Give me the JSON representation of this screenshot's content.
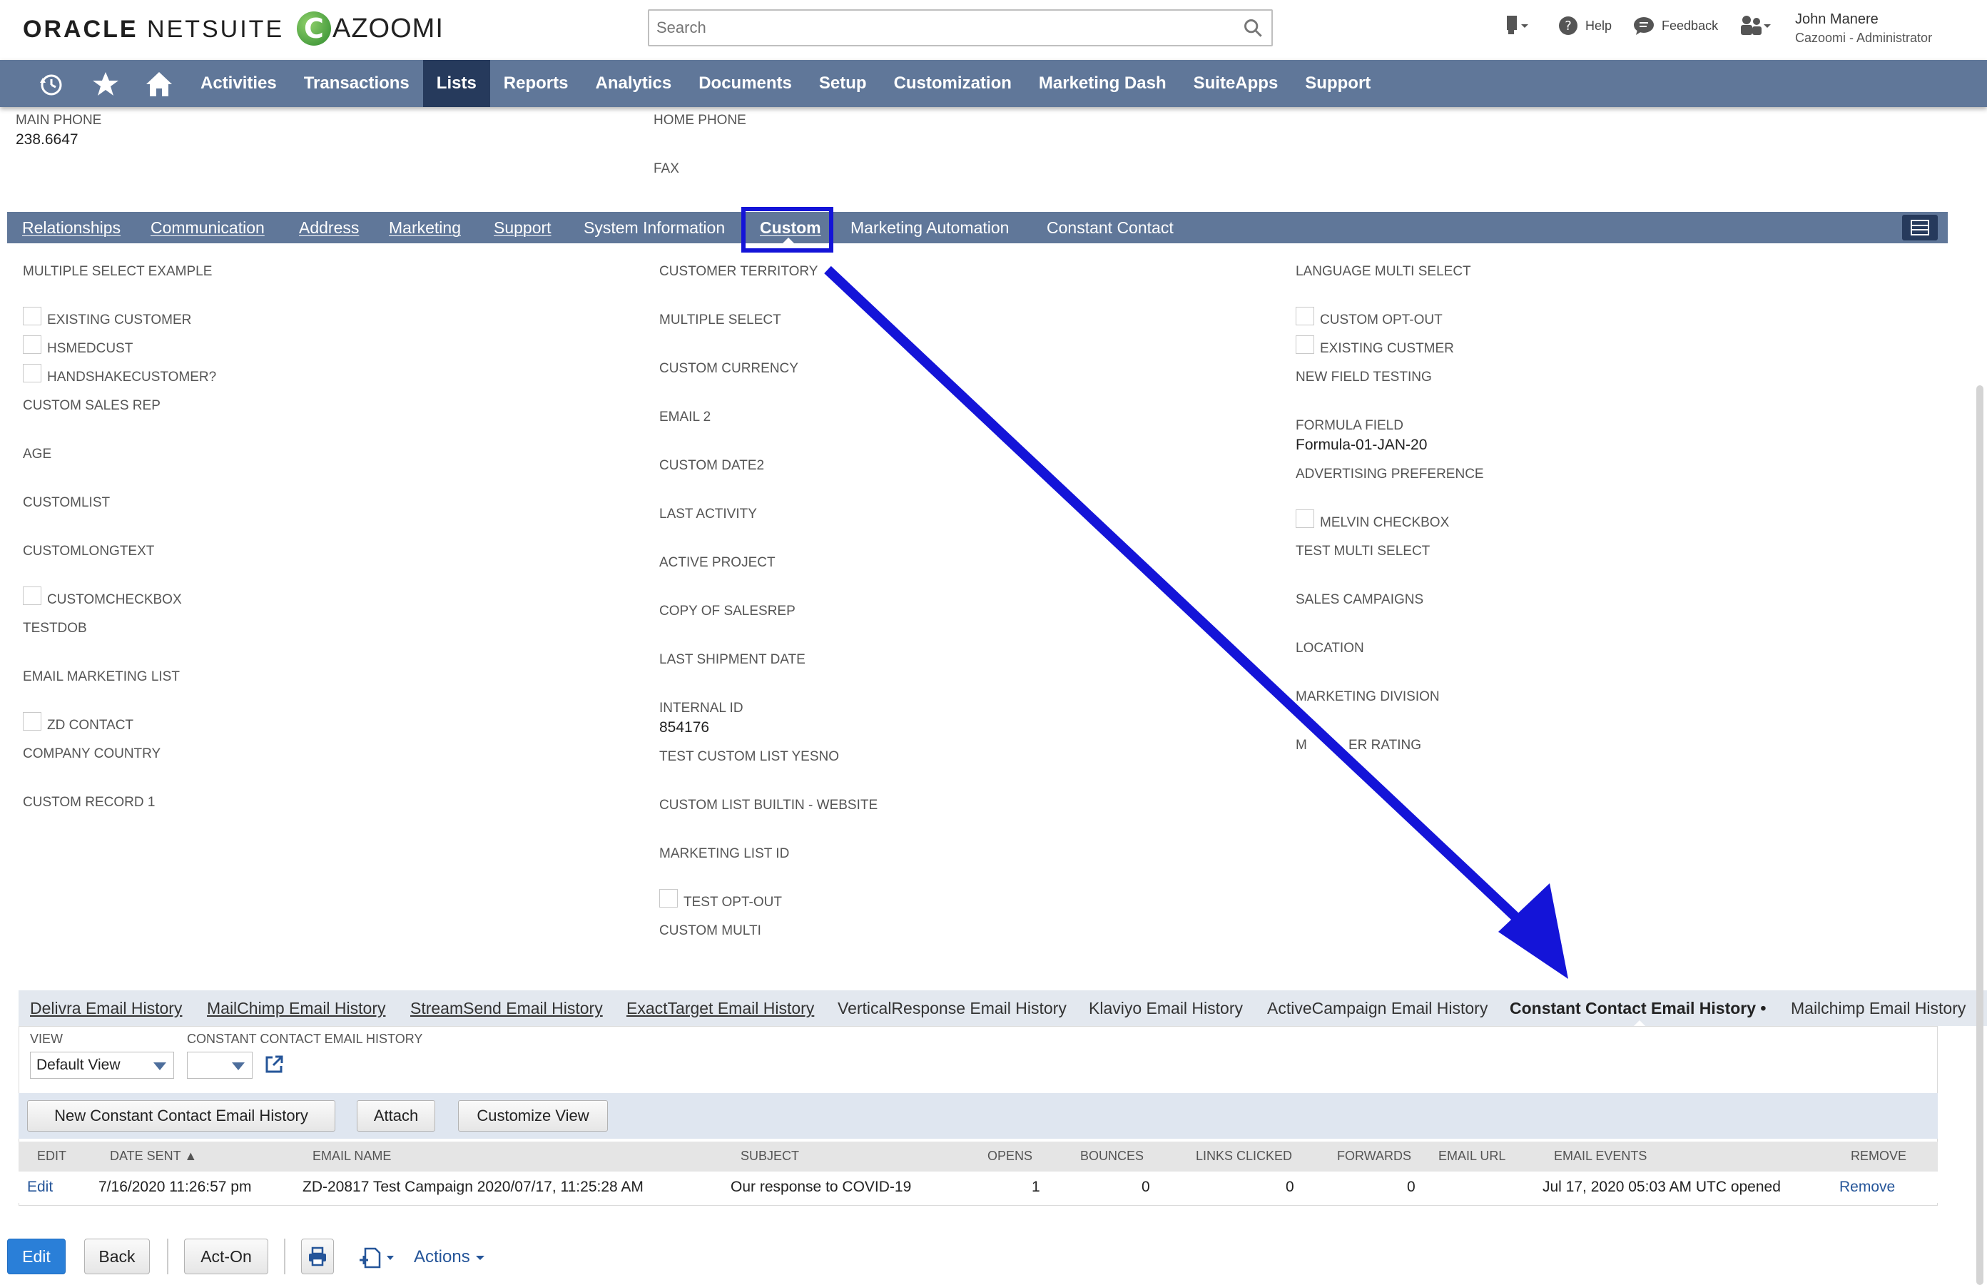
{
  "header": {
    "logo_oracle_bold": "ORACLE",
    "logo_oracle_light": " NETSUITE",
    "logo_cazoomi_letter": "C",
    "logo_cazoomi_rest": "AZOOMI",
    "search_placeholder": "Search",
    "help_label": "Help",
    "feedback_label": "Feedback",
    "user_name": "John Manere",
    "user_role": "Cazoomi - Administrator"
  },
  "nav": {
    "items": [
      "Activities",
      "Transactions",
      "Lists",
      "Reports",
      "Analytics",
      "Documents",
      "Setup",
      "Customization",
      "Marketing Dash",
      "SuiteApps",
      "Support"
    ],
    "active": "Lists"
  },
  "top_fields": {
    "main_phone_label": "MAIN PHONE",
    "main_phone_value": "238.6647",
    "home_phone_label": "HOME PHONE",
    "fax_label": "FAX"
  },
  "subtabs": {
    "items": [
      "Relationships",
      "Communication",
      "Address",
      "Marketing",
      "Support",
      "System Information",
      "Custom",
      "Marketing Automation",
      "Constant Contact"
    ],
    "active": "Custom"
  },
  "custom_fields": {
    "col1": {
      "multiple_select_example": "MULTIPLE SELECT EXAMPLE",
      "existing_customer": "EXISTING CUSTOMER",
      "hsmedcust": "HSMEDCUST",
      "handshakecustomer": "HANDSHAKECUSTOMER?",
      "custom_sales_rep": "CUSTOM SALES REP",
      "age": "AGE",
      "customlist": "CUSTOMLIST",
      "customlongtext": "CUSTOMLONGTEXT",
      "customcheckbox": "CUSTOMCHECKBOX",
      "testdob": "TESTDOB",
      "email_marketing_list": "EMAIL MARKETING LIST",
      "zd_contact": "ZD CONTACT",
      "company_country": "COMPANY COUNTRY",
      "custom_record_1": "CUSTOM RECORD 1"
    },
    "col2": {
      "customer_territory": "CUSTOMER TERRITORY",
      "multiple_select": "MULTIPLE SELECT",
      "custom_currency": "CUSTOM CURRENCY",
      "email_2": "EMAIL 2",
      "custom_date2": "CUSTOM DATE2",
      "last_activity": "LAST ACTIVITY",
      "active_project": "ACTIVE PROJECT",
      "copy_of_salesrep": "COPY OF SALESREP",
      "last_shipment_date": "LAST SHIPMENT DATE",
      "internal_id_label": "INTERNAL ID",
      "internal_id_value": "854176",
      "test_custom_list_yesno": "TEST CUSTOM LIST YESNO",
      "custom_list_builtin_website": "CUSTOM LIST BUILTIN - WEBSITE",
      "marketing_list_id": "MARKETING LIST ID",
      "test_opt_out": "TEST OPT-OUT",
      "custom_multi": "CUSTOM MULTI"
    },
    "col3": {
      "language_multi_select": "LANGUAGE MULTI SELECT",
      "custom_opt_out": "CUSTOM OPT-OUT",
      "existing_custmer": "EXISTING CUSTMER",
      "new_field_testing": "NEW FIELD TESTING",
      "formula_field_label": "FORMULA FIELD",
      "formula_field_value": "Formula-01-JAN-20",
      "advertising_preference": "ADVERTISING PREFERENCE",
      "melvin_checkbox": "MELVIN CHECKBOX",
      "test_multi_select": "TEST MULTI SELECT",
      "sales_campaigns": "SALES CAMPAIGNS",
      "location": "LOCATION",
      "marketing_division": "MARKETING DIVISION",
      "member_rating_a": "M",
      "member_rating_b": "ER RATING"
    }
  },
  "history_tabs": {
    "items": [
      "Delivra Email History",
      "MailChimp Email History",
      "StreamSend Email History",
      "ExactTarget Email History",
      "VerticalResponse Email History",
      "Klaviyo Email History",
      "ActiveCampaign Email History",
      "Constant Contact Email History",
      "Mailchimp Email History"
    ],
    "active_suffix": " •"
  },
  "history_panel": {
    "view_label": "VIEW",
    "view_value": "Default View",
    "cc_label": "CONSTANT CONTACT EMAIL HISTORY",
    "cc_value": "",
    "buttons": {
      "new": "New Constant Contact Email History",
      "attach": "Attach",
      "customize": "Customize View"
    },
    "columns": [
      "EDIT",
      "DATE SENT ▲",
      "EMAIL NAME",
      "SUBJECT",
      "OPENS",
      "BOUNCES",
      "LINKS CLICKED",
      "FORWARDS",
      "EMAIL URL",
      "EMAIL EVENTS",
      "REMOVE"
    ],
    "rows": [
      {
        "edit": "Edit",
        "date_sent": "7/16/2020 11:26:57 pm",
        "email_name": "ZD-20817 Test Campaign 2020/07/17, 11:25:28 AM",
        "subject": "Our response to COVID-19",
        "opens": "1",
        "bounces": "0",
        "links_clicked": "0",
        "forwards": "0",
        "email_url": "",
        "email_events": "Jul 17, 2020 05:03 AM UTC opened",
        "remove": "Remove"
      }
    ]
  },
  "footer_buttons": {
    "edit": "Edit",
    "back": "Back",
    "act_on": "Act-On",
    "actions": "Actions"
  },
  "colors": {
    "nav_bg": "#607799",
    "nav_active": "#263a5c",
    "annotation_blue": "#1414d8",
    "link": "#255599",
    "primary_button": "#2a7fd8"
  }
}
